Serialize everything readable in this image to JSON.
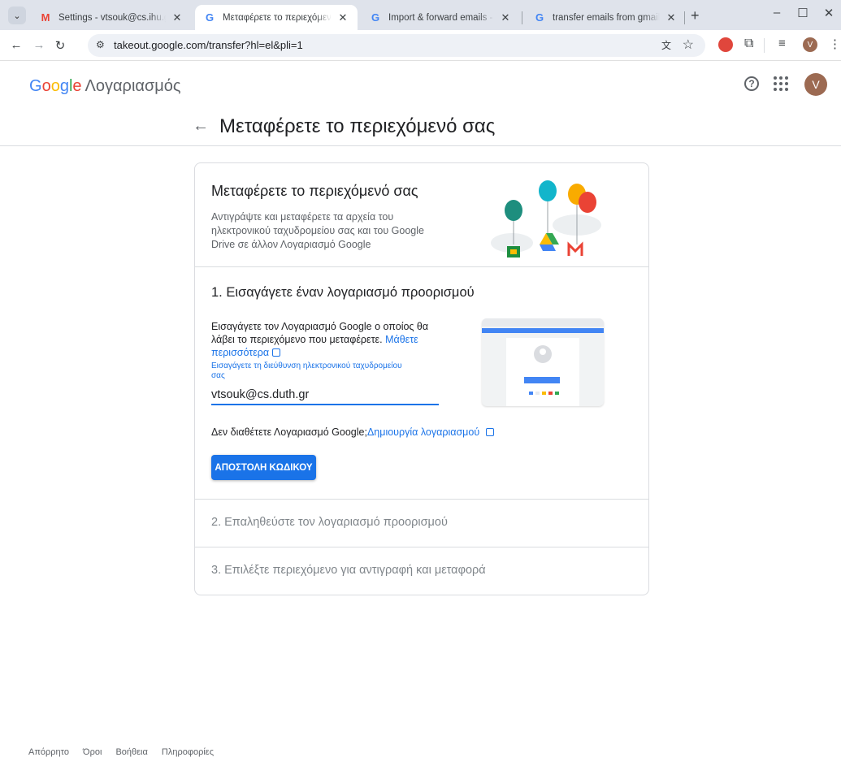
{
  "browser": {
    "tabs": [
      {
        "title": "Settings - vtsouk@cs.ihu.gr - D",
        "icon": "gmail-icon"
      },
      {
        "title": "Μεταφέρετε το περιεχόμενό σα",
        "icon": "google-icon"
      },
      {
        "title": "Import & forward emails - Gma",
        "icon": "google-icon"
      },
      {
        "title": "transfer emails from gmail to a",
        "icon": "google-icon"
      }
    ],
    "url": "takeout.google.com/transfer?hl=el&pli=1",
    "profile_initial": "V"
  },
  "header": {
    "logo_letters": [
      "G",
      "o",
      "o",
      "g",
      "l",
      "e"
    ],
    "product": "Λογαριασμός",
    "avatar_initial": "V"
  },
  "page": {
    "title": "Μεταφέρετε το περιεχόμενό σας"
  },
  "intro": {
    "title": "Μεταφέρετε το περιεχόμενό σας",
    "description": "Αντιγράψτε και μεταφέρετε τα αρχεία του ηλεκτρονικού ταχυδρομείου σας και του Google Drive σε άλλον Λογαριασμό Google"
  },
  "step1": {
    "title": "1. Εισαγάγετε έναν λογαριασμό προορισμού",
    "description": "Εισαγάγετε τον Λογαριασμό Google ο οποίος θα λάβει το περιεχόμενο που μεταφέρετε. ",
    "learn_more": "Μάθετε περισσότερα",
    "field_label": "Εισαγάγετε τη διεύθυνση ηλεκτρονικού ταχυδρομείου σας",
    "email_value": "vtsouk@cs.duth.gr",
    "no_account_text": "Δεν διαθέτετε Λογαριασμό Google;",
    "create_account": "Δημιουργία λογαριασμού",
    "send_code_button": "ΑΠΟΣΤΟΛΗ ΚΩΔΙΚΟΥ"
  },
  "step2": {
    "title": "2. Επαληθεύστε τον λογαριασμό προορισμού"
  },
  "step3": {
    "title": "3. Επιλέξτε περιεχόμενο για αντιγραφή και μεταφορά"
  },
  "footer": {
    "links": [
      "Απόρρητο",
      "Όροι",
      "Βοήθεια",
      "Πληροφορίες"
    ]
  },
  "colors": {
    "primary": "#1a73e8",
    "avatar": "#9c6a52"
  }
}
